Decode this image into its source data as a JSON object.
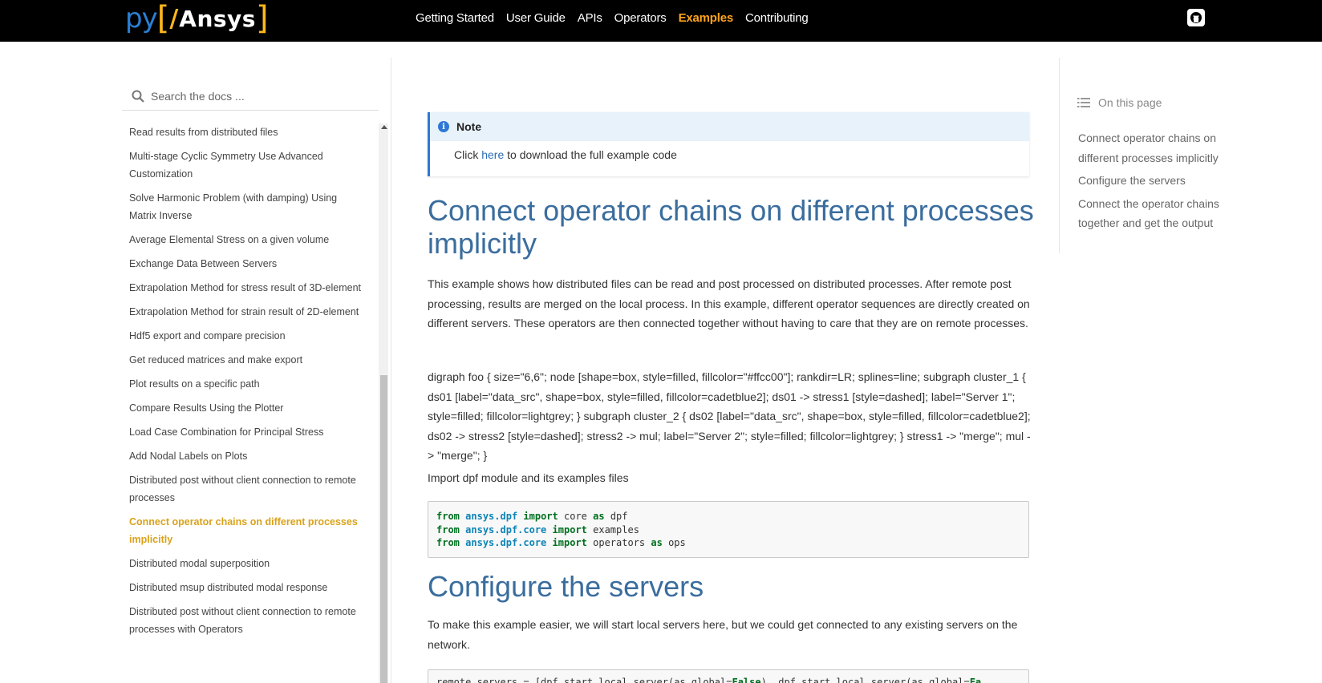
{
  "header": {
    "logo": {
      "py": "py",
      "open_bracket": "[",
      "slash": "/",
      "ansys": "Ansys",
      "close_bracket": "]"
    },
    "nav": [
      "Getting Started",
      "User Guide",
      "APIs",
      "Operators",
      "Examples",
      "Contributing"
    ],
    "active_nav": "Examples"
  },
  "sidebar": {
    "search_placeholder": "Search the docs ...",
    "items": [
      "Read results from distributed files",
      "Multi-stage Cyclic Symmetry Use Advanced Customization",
      "Solve Harmonic Problem (with damping) Using Matrix Inverse",
      "Average Elemental Stress on a given volume",
      "Exchange Data Between Servers",
      "Extrapolation Method for stress result of 3D-element",
      "Extrapolation Method for strain result of 2D-element",
      "Hdf5 export and compare precision",
      "Get reduced matrices and make export",
      "Plot results on a specific path",
      "Compare Results Using the Plotter",
      "Load Case Combination for Principal Stress",
      "Add Nodal Labels on Plots",
      "Distributed post without client connection to remote processes",
      "Connect operator chains on different processes implicitly",
      "Distributed modal superposition",
      "Distributed msup distributed modal response",
      "Distributed post without client connection to remote processes with Operators"
    ],
    "current_index": 14
  },
  "main": {
    "note": {
      "title": "Note",
      "text_before": "Click ",
      "link": "here",
      "text_after": " to download the full example code"
    },
    "title": "Connect operator chains on different processes implicitly",
    "paragraph1": "This example shows how distributed files can be read and post processed on distributed processes. After remote post processing, results are merged on the local process. In this example, different operator sequences are directly created on different servers. These operators are then connected together without having to care that they are on remote processes.",
    "paragraph2": "digraph foo { size=\"6,6\"; node [shape=box, style=filled, fillcolor=\"#ffcc00\"]; rankdir=LR; splines=line; subgraph cluster_1 { ds01 [label=\"data_src\", shape=box, style=filled, fillcolor=cadetblue2]; ds01 -> stress1 [style=dashed]; label=\"Server 1\"; style=filled; fillcolor=lightgrey; } subgraph cluster_2 { ds02 [label=\"data_src\", shape=box, style=filled, fillcolor=cadetblue2]; ds02 -> stress2 [style=dashed]; stress2 -> mul; label=\"Server 2\"; style=filled; fillcolor=lightgrey; } stress1 -> \"merge\"; mul -> \"merge\"; }",
    "paragraph3": "Import dpf module and its examples files",
    "code1": [
      {
        "kw1": "from",
        "mod": "ansys.dpf",
        "kw2": "import",
        "name": "core",
        "kw3": "as",
        "alias": "dpf"
      },
      {
        "kw1": "from",
        "mod": "ansys.dpf.core",
        "kw2": "import",
        "name": "examples",
        "kw3": "",
        "alias": ""
      },
      {
        "kw1": "from",
        "mod": "ansys.dpf.core",
        "kw2": "import",
        "name": "operators",
        "kw3": "as",
        "alias": "ops"
      }
    ],
    "title2": "Configure the servers",
    "paragraph4": "To make this example easier, we will start local servers here, but we could get connected to any existing servers on the network.",
    "code2": {
      "a": "remote_servers = [dpf.start_local_server(as_global=",
      "b": "False",
      "c": "), dpf.start_local_server(as_global=",
      "d": "Fa"
    }
  },
  "toc": {
    "heading": "On this page",
    "items": [
      "Connect operator chains on different processes implicitly",
      "Configure the servers",
      "Connect the operator chains together and get the output"
    ]
  },
  "colors": {
    "accent": "#ffa41c",
    "heading": "#3a6d9e",
    "link": "#2a6db5",
    "current_item": "#d9a21b"
  }
}
